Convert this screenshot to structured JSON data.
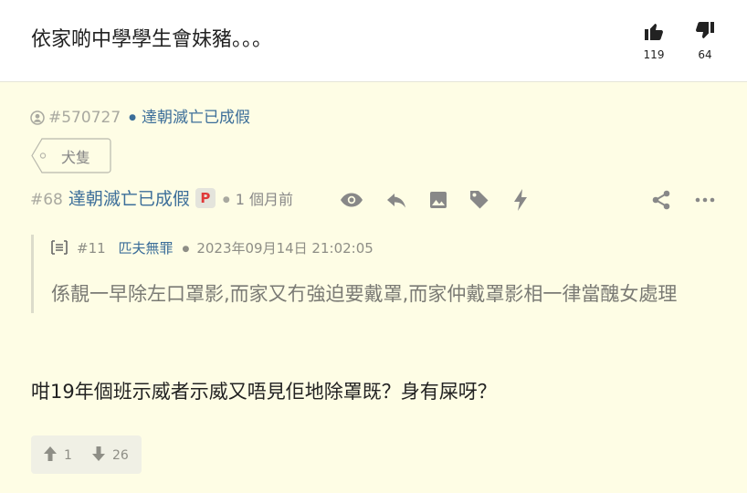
{
  "thread": {
    "title": "依家啲中學學生會妹豬。。。",
    "likes": "119",
    "dislikes": "64"
  },
  "post": {
    "user_id": "#570727",
    "username": "達朝滅亡已成假",
    "tag": "犬隻",
    "floor": "#68",
    "badge": "P",
    "time": "1 個月前",
    "quote": {
      "floor": "#11",
      "author": "匹夫無罪",
      "datetime": "2023年09月14日 21:02:05",
      "text": "係靚一早除左口罩影,而家又冇強迫要戴罩,而家仲戴罩影相一律當醜女處理"
    },
    "content": "咁19年個班示威者示威又唔見佢地除罩既？身有屎呀？",
    "upvotes": "1",
    "downvotes": "26"
  },
  "icons": {
    "like": "thumbs-up-icon",
    "dislike": "thumbs-down-icon",
    "user": "user-icon",
    "tag": "tag-icon",
    "view": "eye-icon",
    "reply": "reply-icon",
    "image": "image-icon",
    "label": "label-icon",
    "flash": "lightning-icon",
    "share": "share-icon",
    "more": "more-icon",
    "quote": "quote-icon",
    "upvote": "arrow-up-icon",
    "downvote": "arrow-down-icon"
  },
  "colors": {
    "background": "#fefde5",
    "link": "#3c6e99",
    "badge": "#e03a3a"
  }
}
